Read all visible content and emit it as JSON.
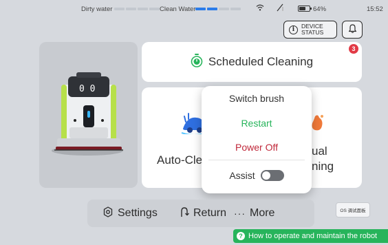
{
  "status_bar": {
    "dirty_water_label": "Dirty water",
    "clean_water_label": "Clean Water",
    "dirty_water_level": 0,
    "clean_water_level": 0.5,
    "battery": "64%",
    "battery_level": 0.64,
    "time": "15:52"
  },
  "header": {
    "device_status_line1": "DEVICE",
    "device_status_line2": "STATUS"
  },
  "scheduled": {
    "label": "Scheduled Cleaning",
    "badge_count": "3"
  },
  "modes": {
    "auto_label": "Auto-Cle",
    "manual_line1": "ual",
    "manual_line2": "ning"
  },
  "popup": {
    "switch_brush": "Switch brush",
    "restart": "Restart",
    "power_off": "Power Off",
    "assist": "Assist",
    "assist_on": false
  },
  "bottom_nav": {
    "settings": "Settings",
    "return": "Return",
    "more": "More"
  },
  "os_button": "OS 调试面板",
  "help_banner": "How to operate and maintain the robot",
  "colors": {
    "accent_green": "#27b45b",
    "danger_red": "#c0283a",
    "water_blue": "#2b7ce9",
    "badge_red": "#e23a46"
  },
  "icons": [
    "water-drop-icon",
    "wifi-icon",
    "no-signal-icon",
    "battery-icon",
    "info-icon",
    "bell-icon",
    "timer-icon",
    "gear-icon",
    "return-icon",
    "more-dots-icon",
    "help-icon"
  ]
}
